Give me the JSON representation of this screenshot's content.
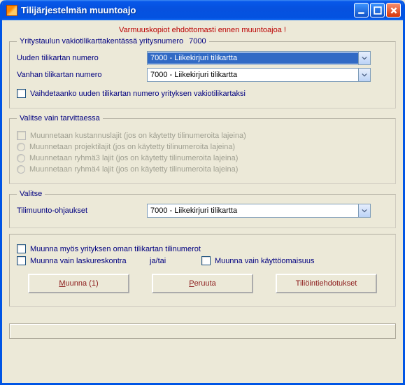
{
  "window": {
    "title": "Tilijärjestelmän muuntoajo"
  },
  "warning": "Varmuuskopiot ehdottomasti ennen muuntoajoa !",
  "group1": {
    "legend_text": "Yritystaulun vakiotilikarttakentässä yritysnumero",
    "legend_value": "7000",
    "new_label": "Uuden tilikartan numero",
    "new_value": "7000 - Liikekirjuri tilikartta",
    "old_label": "Vanhan tilikartan numero",
    "old_value": "7000 - Liikekirjuri tilikartta",
    "swap_label": "Vaihdetaanko uuden tilikartan numero yrityksen vakiotilikartaksi"
  },
  "group2": {
    "legend": "Valitse vain tarvittaessa",
    "opt1": "Muunnetaan kustannuslajit (jos on käytetty tilinumeroita lajeina)",
    "opt2": "Muunnetaan projektilajit (jos on käytetty tilinumeroita lajeina)",
    "opt3": "Muunnetaan ryhmä3 lajit (jos on käytetty tilinumeroita lajeina)",
    "opt4": "Muunnetaan ryhmä4 lajit (jos on käytetty tilinumeroita lajeina)"
  },
  "group3": {
    "legend": "Valitse",
    "label": "Tilimuunto-ohjaukset",
    "value": "7000 - Liikekirjuri tilikartta"
  },
  "group4": {
    "opt_own": "Muunna myös yrityksen oman tilikartan tilinumerot",
    "opt_lr": "Muunna vain laskureskontra",
    "andor": "ja/tai",
    "opt_ko": "Muunna vain käyttöomaisuus"
  },
  "buttons": {
    "convert_pre": "",
    "convert": "Muunna (1)",
    "cancel": "Peruuta",
    "suggestions": "Tiliöintiehdotukset"
  }
}
